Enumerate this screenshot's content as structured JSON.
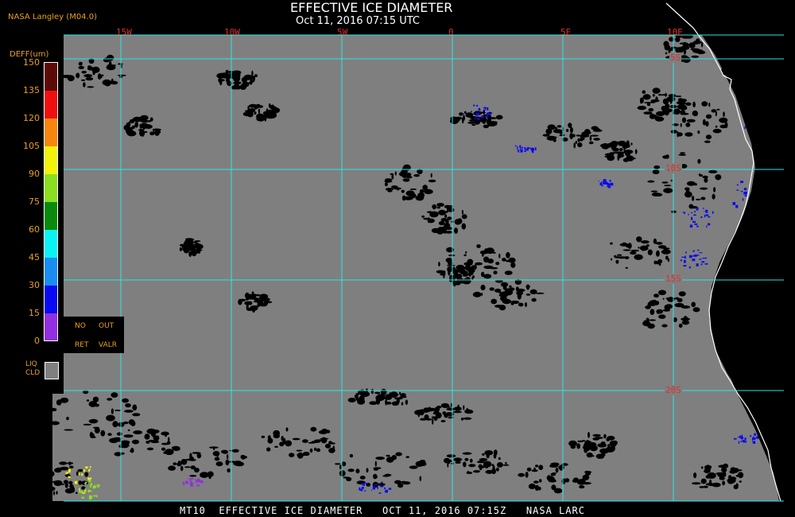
{
  "header": {
    "title": "EFFECTIVE ICE DIAMETER",
    "subtitle": "Oct 11, 2016 07:15 UTC",
    "credit": "NASA Langley (M04.0)"
  },
  "map": {
    "longitude_labels": [
      "15W",
      "10W",
      "5W",
      "0",
      "5E",
      "10E"
    ],
    "latitude_labels": [
      "5S",
      "10S",
      "15S",
      "20S"
    ],
    "colors": {
      "background": "#7f7f7f",
      "grid": "#2ee6e6",
      "coast": "#ffffff",
      "label": "#e0302a",
      "clear": "#000000"
    }
  },
  "legend": {
    "title": "DEFF(um)",
    "ticks": [
      "150",
      "135",
      "120",
      "105",
      "90",
      "75",
      "60",
      "45",
      "30",
      "15",
      "0"
    ],
    "colors": [
      "#5c0a08",
      "#ee1010",
      "#f7860e",
      "#f2f20a",
      "#8ae020",
      "#0a8a0a",
      "#0af2f2",
      "#1a8cf2",
      "#0a0af0",
      "#9030e0"
    ],
    "no_ret": {
      "no": "NO",
      "ret": "RET",
      "out": "OUT",
      "valr": "VALR"
    },
    "liq": {
      "line1": "LIQ",
      "line2": "CLD",
      "color": "#7f7f7f"
    }
  },
  "footer": "MT10  EFFECTIVE ICE DIAMETER   OCT 11, 2016 07:15Z   NASA LARC"
}
